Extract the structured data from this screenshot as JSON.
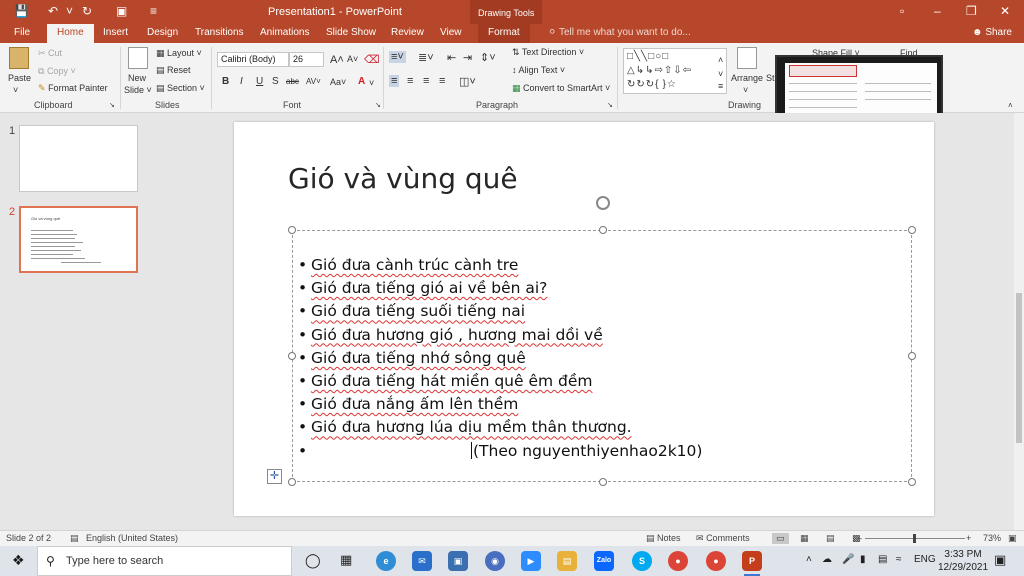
{
  "window": {
    "title": "Presentation1 - PowerPoint",
    "contextual_group": "Drawing Tools",
    "user_initials": "☰"
  },
  "tabs": [
    "File",
    "Home",
    "Insert",
    "Design",
    "Transitions",
    "Animations",
    "Slide Show",
    "Review",
    "View",
    "Format"
  ],
  "active_tab": "Home",
  "tell_me": "Tell me what you want to do...",
  "share": "Share",
  "ribbon": {
    "clipboard": {
      "paste": "Paste",
      "cut": "Cut",
      "copy": "Copy",
      "format_painter": "Format Painter",
      "label": "Clipboard"
    },
    "slides": {
      "new_slide": "New",
      "new_slide2": "Slide ˅",
      "layout": "Layout ˅",
      "reset": "Reset",
      "section": "Section ˅",
      "label": "Slides"
    },
    "font": {
      "family": "Calibri (Body)",
      "size": "26",
      "label": "Font"
    },
    "paragraph": {
      "text_direction": "Text Direction ˅",
      "align_text": "Align Text ˅",
      "smartart": "Convert to SmartArt ˅",
      "label": "Paragraph"
    },
    "drawing": {
      "arrange": "Arrange",
      "quick_styles": "St",
      "shape_fill": "Shape Fill ˅",
      "find": "Find",
      "label": "Drawing"
    }
  },
  "thumbnails": [
    {
      "num": "1"
    },
    {
      "num": "2",
      "title": "Gió và vùng quê"
    }
  ],
  "slide": {
    "title": "Gió và vùng quê",
    "bullets": [
      "Gió đưa cành trúc cành tre",
      "Gió đưa tiếng gió ai về bên ai?",
      "Gió đưa tiếng suối tiếng nai",
      "Gió đưa hương gió , hương mai dồi về",
      "Gió đưa tiếng nhớ sông quê",
      "Gió đưa tiếng hát miền quê êm đềm",
      "Gió đưa nắng ấm lên thềm",
      "Gió đưa hương lúa dịu mềm thân thương."
    ],
    "attribution": "(Theo nguyenthiyenhao2k10)"
  },
  "statusbar": {
    "slide_info": "Slide 2 of 2",
    "language": "English (United States)",
    "notes": "Notes",
    "comments": "Comments",
    "zoom": "73%"
  },
  "taskbar": {
    "search_placeholder": "Type here to search",
    "zalo": "Zalo",
    "lang": "ENG",
    "time": "3:33 PM",
    "date": "12/29/2021"
  },
  "colors": {
    "accent": "#b7472a",
    "accent_dark": "#a23b22",
    "selection": "#e07352"
  }
}
